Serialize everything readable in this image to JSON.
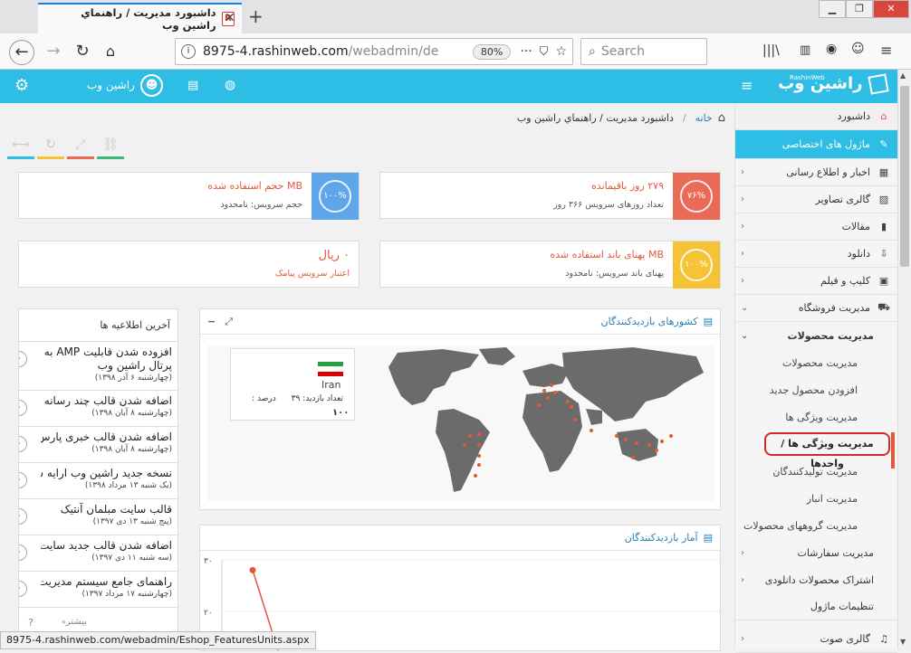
{
  "browser": {
    "tab_title": "داشبورد مديريت / راهنماي راشين وب",
    "url_main": "8975-4.rashinweb.com",
    "url_dim": "/webadmin/de",
    "zoom": "80%",
    "search_placeholder": "Search",
    "status_url": "8975-4.rashinweb.com/webadmin/Eshop_FeaturesUnits.aspx"
  },
  "header": {
    "user_name": "راشين وب",
    "logo_text": "راشين وب",
    "logo_sub": "RashinWeb"
  },
  "breadcrumb": {
    "home": "خانه",
    "path": "داشبورد مديريت / راهنماي راشين وب"
  },
  "stats": {
    "days": {
      "value": "۲۷۹ روز باقیمانده",
      "sub": "تعداد روزهای سرویس ۳۶۶ روز",
      "percent": "۷۶%",
      "color": "#e96a57"
    },
    "volume": {
      "value": "MB حجم استفاده شده",
      "sub": "حجم سرویس: نامحدود",
      "percent": "۱۰۰%",
      "color": "#5ea5ea"
    },
    "bandwidth": {
      "value": "MB پهنای باند استفاده شده",
      "sub": "پهنای باند سرویس: نامحدود",
      "percent": "۱۰۰%",
      "color": "#f6c336"
    },
    "sms": {
      "value": "۰ ریال",
      "sub": "اعتبار سرویس پیامک"
    }
  },
  "map_panel": {
    "title": "کشورهای بازدیدکنندگان",
    "country": "Iran",
    "visits_label": "تعداد بازدید:",
    "visits_value": "۳۹",
    "percent_label": "درصد :",
    "percent_value": "۱۰۰"
  },
  "stats_panel": {
    "title": "آمار بازدیدکنندگان",
    "y_ticks": [
      "۳۰",
      "۲۰"
    ]
  },
  "chart_data": {
    "type": "line",
    "x": [
      "",
      ""
    ],
    "series": [
      {
        "values": [
          28,
          0
        ]
      }
    ],
    "ylim": [
      18,
      32
    ]
  },
  "news": {
    "title": "آخرین اطلاعیه ها",
    "more": "بیشتر",
    "help": "?",
    "items": [
      {
        "title": "افزوده شدن قابلیت AMP به پرتال راشین وب",
        "date": "(چهارشنبه ۶ آذر ۱۳۹۸)"
      },
      {
        "title": "اضافه شدن قالب چند رسانه ای",
        "date": "(چهارشنبه ۸ آبان ۱۳۹۸)"
      },
      {
        "title": "اضافه شدن قالب خبری پارس نیوز",
        "date": "(چهارشنبه ۸ آبان ۱۳۹۸)"
      },
      {
        "title": "نسخه جدید راشین وب ارایه شد...",
        "date": "(یک شنبه ۱۳ مرداد ۱۳۹۸)"
      },
      {
        "title": "قالب سایت مبلمان آنتیک",
        "date": "(پنج شنبه ۱۳ دی ۱۳۹۷)"
      },
      {
        "title": "اضافه شدن قالب جدید سایت",
        "date": "(سه شنبه ۱۱ دی ۱۳۹۷)"
      },
      {
        "title": "راهنمای جامع سیستم مدیریت",
        "date": "(چهارشنبه ۱۷ مرداد ۱۳۹۷)"
      }
    ]
  },
  "sidebar": {
    "dashboard": "داشبورد",
    "modules": "ماژول های اختصاصی",
    "items": [
      {
        "label": "اخبار و اطلاع رسانی",
        "icon": "newspaper-icon"
      },
      {
        "label": "گالری تصاویر",
        "icon": "image-icon"
      },
      {
        "label": "مقالات",
        "icon": "file-icon"
      },
      {
        "label": "دانلود",
        "icon": "download-icon"
      },
      {
        "label": "کلیپ و فیلم",
        "icon": "film-icon"
      }
    ],
    "shop": "مدیریت فروشگاه",
    "products_mgmt": "مدیریت محصولات",
    "sub_items": [
      "مديريت محصولات",
      "افزودن محصول جديد",
      "مديريت ويژگی ها",
      "مدیریت ویژگی ها / واحدها",
      "مديريت توليدکنندگان",
      "مديريت انبار",
      "مديريت گروههای محصولات"
    ],
    "orders": "مديريت سفارشات",
    "download_share": "اشتراک محصولات دانلودی",
    "module_settings": "تنظيمات ماژول",
    "audio_gallery": "گالری صوت"
  }
}
